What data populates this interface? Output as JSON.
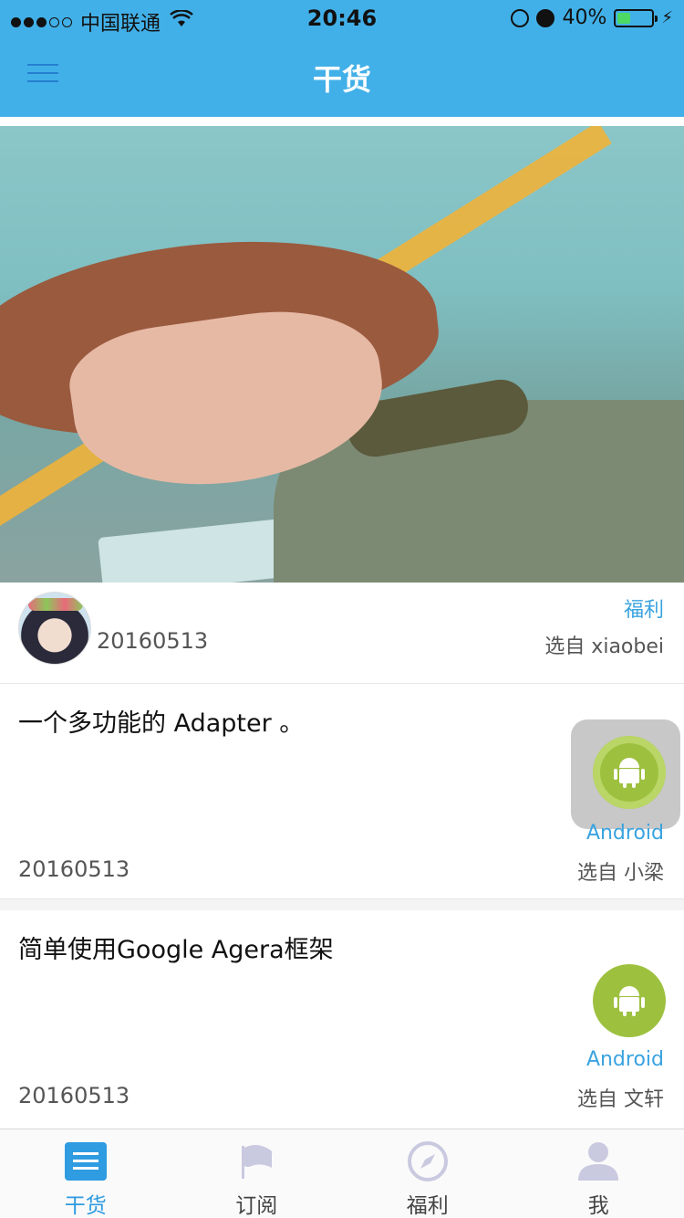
{
  "status_bar": {
    "carrier": "中国联通",
    "time": "20:46",
    "battery": "40%",
    "battery_level": 0.4
  },
  "nav": {
    "title": "干货"
  },
  "hero": {
    "post": {
      "date": "20160513",
      "tag": "福利",
      "by": "选自 xiaobei"
    }
  },
  "posts": [
    {
      "title": "一个多功能的 Adapter 。",
      "date": "20160513",
      "tag": "Android",
      "by": "选自 小梁"
    },
    {
      "title": "简单使用Google Agera框架",
      "date": "20160513",
      "tag": "Android",
      "by": "选自 文轩"
    }
  ],
  "tabbar": {
    "items": [
      {
        "label": "干货",
        "icon": "list-icon",
        "active": true
      },
      {
        "label": "订阅",
        "icon": "flag-icon",
        "active": false
      },
      {
        "label": "福利",
        "icon": "compass-icon",
        "active": false
      },
      {
        "label": "我",
        "icon": "person-icon",
        "active": false
      }
    ]
  },
  "colors": {
    "primary": "#42b0e8",
    "accent": "#2f9be0",
    "android": "#9dc13f"
  }
}
